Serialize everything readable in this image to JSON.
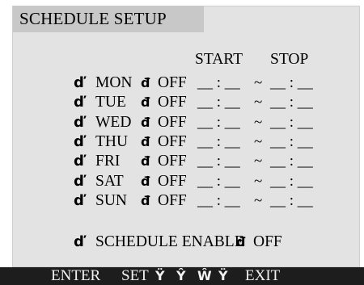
{
  "title": "SCHEDULE SETUP",
  "headers": {
    "start": "START",
    "stop": "STOP"
  },
  "bullet_glyph": "ď",
  "separator_glyph": "đ",
  "days": [
    {
      "day": "MON",
      "state": "OFF",
      "start": "__ : __",
      "tilde": "~",
      "stop": "__ : __"
    },
    {
      "day": "TUE",
      "state": "OFF",
      "start": "__ : __",
      "tilde": "~",
      "stop": "__ : __"
    },
    {
      "day": "WED",
      "state": "OFF",
      "start": "__ : __",
      "tilde": "~",
      "stop": "__ : __"
    },
    {
      "day": "THU",
      "state": "OFF",
      "start": "__ : __",
      "tilde": "~",
      "stop": "__ : __"
    },
    {
      "day": "FRI",
      "state": "OFF",
      "start": "__ : __",
      "tilde": "~",
      "stop": "__ : __"
    },
    {
      "day": "SAT",
      "state": "OFF",
      "start": "__ : __",
      "tilde": "~",
      "stop": "__ : __"
    },
    {
      "day": "SUN",
      "state": "OFF",
      "start": "__ : __",
      "tilde": "~",
      "stop": "__ : __"
    }
  ],
  "schedule_enable": {
    "label": "SCHEDULE ENABLE",
    "state": "OFF"
  },
  "footer": {
    "enter_label": "ENTER",
    "set_label": "SET",
    "exit_label": "EXIT",
    "arrow_icons": [
      "up-arrow-icon",
      "down-arrow-icon",
      "left-arrow-icon",
      "right-arrow-icon"
    ],
    "arrow_glyphs": [
      "Ÿ",
      "Ŷ",
      "Ŵ",
      "Ÿ"
    ]
  }
}
